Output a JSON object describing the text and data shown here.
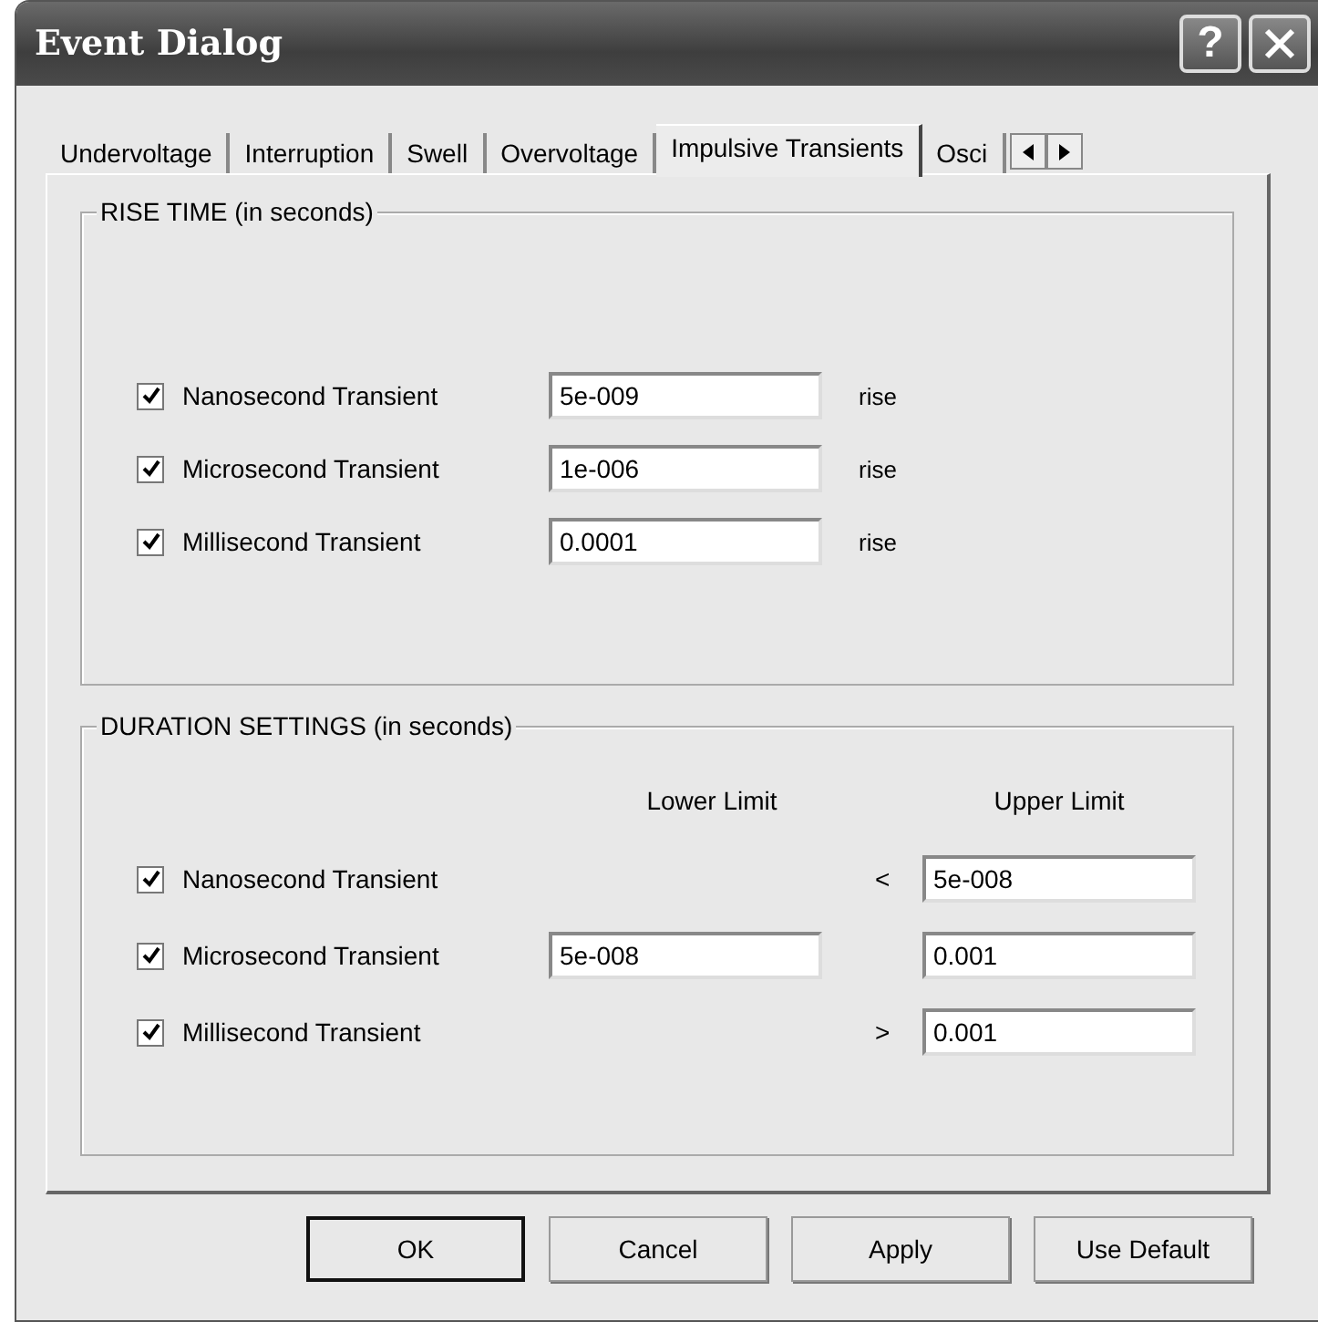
{
  "window": {
    "title": "Event Dialog",
    "help": "?"
  },
  "tabs": [
    {
      "label": "Undervoltage",
      "selected": false
    },
    {
      "label": "Interruption",
      "selected": false
    },
    {
      "label": "Swell",
      "selected": false
    },
    {
      "label": "Overvoltage",
      "selected": false
    },
    {
      "label": "Impulsive Transients",
      "selected": true
    },
    {
      "label": "Osci",
      "selected": false
    }
  ],
  "rise_time": {
    "title": "RISE TIME (in seconds)",
    "rows": [
      {
        "label": "Nanosecond Transient",
        "checked": true,
        "value": "5e-009",
        "unit": "rise"
      },
      {
        "label": "Microsecond Transient",
        "checked": true,
        "value": "1e-006",
        "unit": "rise"
      },
      {
        "label": "Millisecond Transient",
        "checked": true,
        "value": "0.0001",
        "unit": "rise"
      }
    ]
  },
  "duration": {
    "title": "DURATION SETTINGS (in seconds)",
    "lower_header": "Lower Limit",
    "upper_header": "Upper Limit",
    "rows": [
      {
        "label": "Nanosecond Transient",
        "checked": true,
        "comparator": "<",
        "upper": "5e-008"
      },
      {
        "label": "Microsecond Transient",
        "checked": true,
        "lower": "5e-008",
        "upper": "0.001"
      },
      {
        "label": "Millisecond Transient",
        "checked": true,
        "comparator": ">",
        "upper": "0.001"
      }
    ]
  },
  "buttons": [
    {
      "label": "OK",
      "default": true
    },
    {
      "label": "Cancel",
      "default": false
    },
    {
      "label": "Apply",
      "default": false
    },
    {
      "label": "Use Default",
      "default": false
    }
  ]
}
